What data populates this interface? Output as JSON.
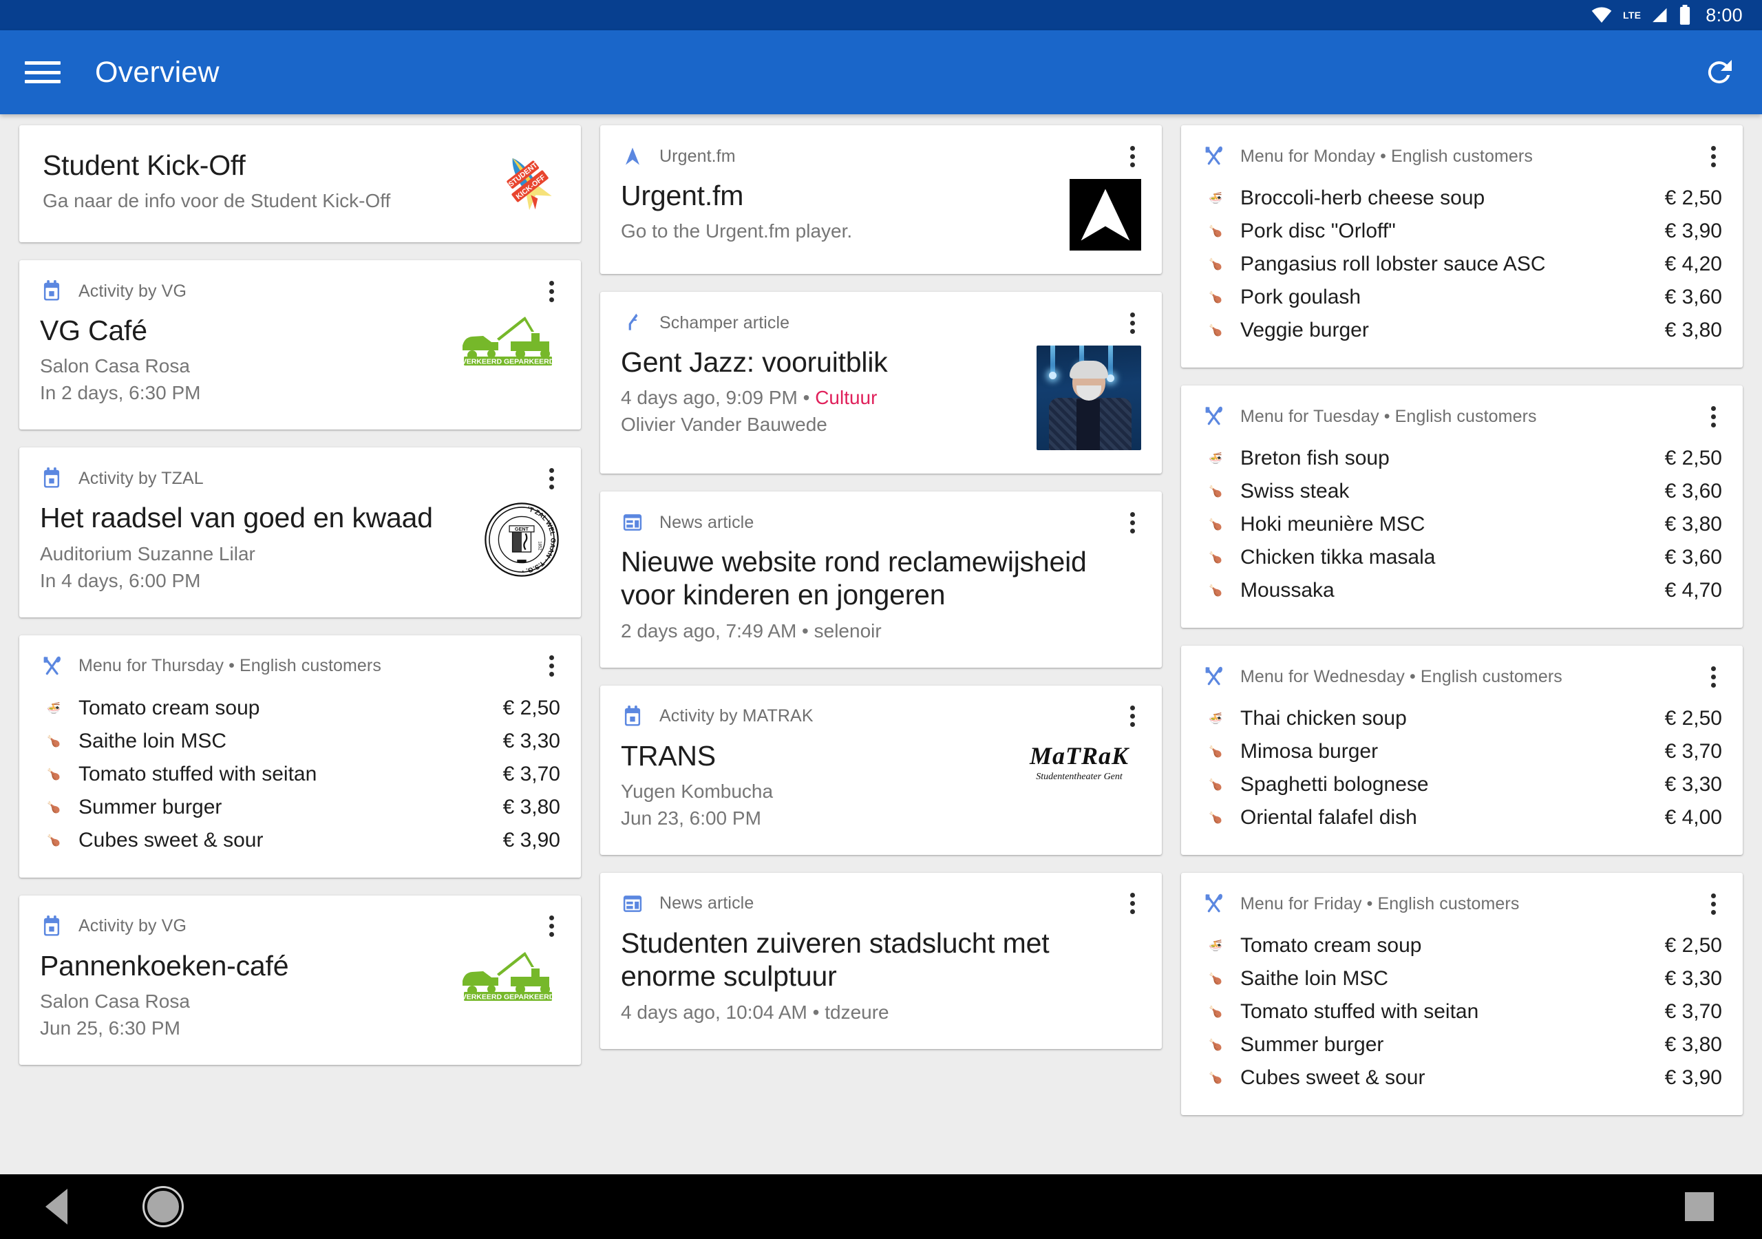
{
  "statusbar": {
    "time": "8:00",
    "network_label": "LTE"
  },
  "appbar": {
    "title": "Overview",
    "menu_icon": "hamburger-menu-icon",
    "refresh_icon": "refresh-icon"
  },
  "columns": [
    {
      "cards": [
        {
          "type": "promo",
          "title": "Student Kick-Off",
          "subtitle": "Ga naar de info voor de Student Kick-Off",
          "art": "student-kick-off-rocket-logo"
        },
        {
          "type": "activity",
          "head_icon": "calendar-icon",
          "head_label": "Activity by VG",
          "title": "VG Café",
          "location": "Salon Casa Rosa",
          "time": "In 2 days, 6:30 PM",
          "art": "verkeerd-geparkeerd-tow-truck-logo"
        },
        {
          "type": "activity",
          "head_icon": "calendar-icon",
          "head_label": "Activity by TZAL",
          "title": "Het raadsel van goed en kwaad",
          "location": "Auditorium Suzanne Lilar",
          "time": "In 4 days, 6:00 PM",
          "art": "tzal-seal-logo"
        },
        {
          "type": "menu",
          "head_icon": "cutlery-icon",
          "head_label": "Menu for Thursday • English customers",
          "items": [
            {
              "icon": "soup-bowl-icon",
              "name": "Tomato cream soup",
              "price": "€ 2,50"
            },
            {
              "icon": "meat-icon",
              "name": "Saithe loin MSC",
              "price": "€ 3,30"
            },
            {
              "icon": "meat-icon",
              "name": "Tomato stuffed with seitan",
              "price": "€ 3,70"
            },
            {
              "icon": "meat-icon",
              "name": "Summer burger",
              "price": "€ 3,80"
            },
            {
              "icon": "meat-icon",
              "name": "Cubes sweet & sour",
              "price": "€ 3,90"
            }
          ]
        },
        {
          "type": "activity",
          "head_icon": "calendar-icon",
          "head_label": "Activity by VG",
          "title": "Pannenkoeken-café",
          "location": "Salon Casa Rosa",
          "time": "Jun 25, 6:30 PM",
          "art": "verkeerd-geparkeerd-tow-truck-logo"
        }
      ]
    },
    {
      "cards": [
        {
          "type": "link",
          "head_icon": "urgentfm-arrow-icon",
          "head_label": "Urgent.fm",
          "title": "Urgent.fm",
          "subtitle": "Go to the Urgent.fm player.",
          "art": "urgentfm-logo"
        },
        {
          "type": "article",
          "head_icon": "music-note-icon",
          "head_label": "Schamper article",
          "title": "Gent Jazz: vooruitblik",
          "meta": "4 days ago, 9:09 PM • ",
          "category": "Cultuur",
          "author": "Olivier Vander Bauwede",
          "art": "article-thumbnail-jazz-musician"
        },
        {
          "type": "news",
          "head_icon": "newspaper-icon",
          "head_label": "News article",
          "title": "Nieuwe website rond reclamewijsheid voor kinderen en jongeren",
          "meta": "2 days ago, 7:49 AM • selenoir"
        },
        {
          "type": "activity",
          "head_icon": "calendar-icon",
          "head_label": "Activity by MATRAK",
          "title": "TRANS",
          "location": "Yugen Kombucha",
          "time": "Jun 23, 6:00 PM",
          "art": "matrak-studententheater-gent-logo"
        },
        {
          "type": "news",
          "head_icon": "newspaper-icon",
          "head_label": "News article",
          "title": "Studenten zuiveren stadslucht met enorme sculptuur",
          "meta": "4 days ago, 10:04 AM • tdzeure"
        }
      ]
    },
    {
      "cards": [
        {
          "type": "menu",
          "head_icon": "cutlery-icon",
          "head_label": "Menu for Monday • English customers",
          "items": [
            {
              "icon": "soup-bowl-icon",
              "name": "Broccoli-herb cheese soup",
              "price": "€ 2,50"
            },
            {
              "icon": "meat-icon",
              "name": "Pork disc \"Orloff\"",
              "price": "€ 3,90"
            },
            {
              "icon": "meat-icon",
              "name": "Pangasius roll lobster sauce ASC",
              "price": "€ 4,20"
            },
            {
              "icon": "meat-icon",
              "name": "Pork goulash",
              "price": "€ 3,60"
            },
            {
              "icon": "meat-icon",
              "name": "Veggie burger",
              "price": "€ 3,80"
            }
          ]
        },
        {
          "type": "menu",
          "head_icon": "cutlery-icon",
          "head_label": "Menu for Tuesday • English customers",
          "items": [
            {
              "icon": "soup-bowl-icon",
              "name": "Breton fish soup",
              "price": "€ 2,50"
            },
            {
              "icon": "meat-icon",
              "name": "Swiss steak",
              "price": "€ 3,60"
            },
            {
              "icon": "meat-icon",
              "name": "Hoki meunière MSC",
              "price": "€ 3,80"
            },
            {
              "icon": "meat-icon",
              "name": "Chicken tikka masala",
              "price": "€ 3,60"
            },
            {
              "icon": "meat-icon",
              "name": "Moussaka",
              "price": "€ 4,70"
            }
          ]
        },
        {
          "type": "menu",
          "head_icon": "cutlery-icon",
          "head_label": "Menu for Wednesday • English customers",
          "items": [
            {
              "icon": "soup-bowl-icon",
              "name": "Thai chicken soup",
              "price": "€ 2,50"
            },
            {
              "icon": "meat-icon",
              "name": "Mimosa burger",
              "price": "€ 3,70"
            },
            {
              "icon": "meat-icon",
              "name": "Spaghetti bolognese",
              "price": "€ 3,30"
            },
            {
              "icon": "meat-icon",
              "name": "Oriental falafel dish",
              "price": "€ 4,00"
            }
          ]
        },
        {
          "type": "menu",
          "head_icon": "cutlery-icon",
          "head_label": "Menu for Friday • English customers",
          "items": [
            {
              "icon": "soup-bowl-icon",
              "name": "Tomato cream soup",
              "price": "€ 2,50"
            },
            {
              "icon": "meat-icon",
              "name": "Saithe loin MSC",
              "price": "€ 3,30"
            },
            {
              "icon": "meat-icon",
              "name": "Tomato stuffed with seitan",
              "price": "€ 3,70"
            },
            {
              "icon": "meat-icon",
              "name": "Summer burger",
              "price": "€ 3,80"
            },
            {
              "icon": "meat-icon",
              "name": "Cubes sweet & sour",
              "price": "€ 3,90"
            }
          ]
        }
      ]
    }
  ],
  "navbar": {
    "back": "back-icon",
    "home": "home-icon",
    "recents": "recents-icon"
  },
  "colors": {
    "appbar": "#1a66c9",
    "statusbar": "#073f8f",
    "accent_icon": "#5b87e0",
    "category_pink": "#e0215b",
    "logo_green": "#76b82a"
  }
}
